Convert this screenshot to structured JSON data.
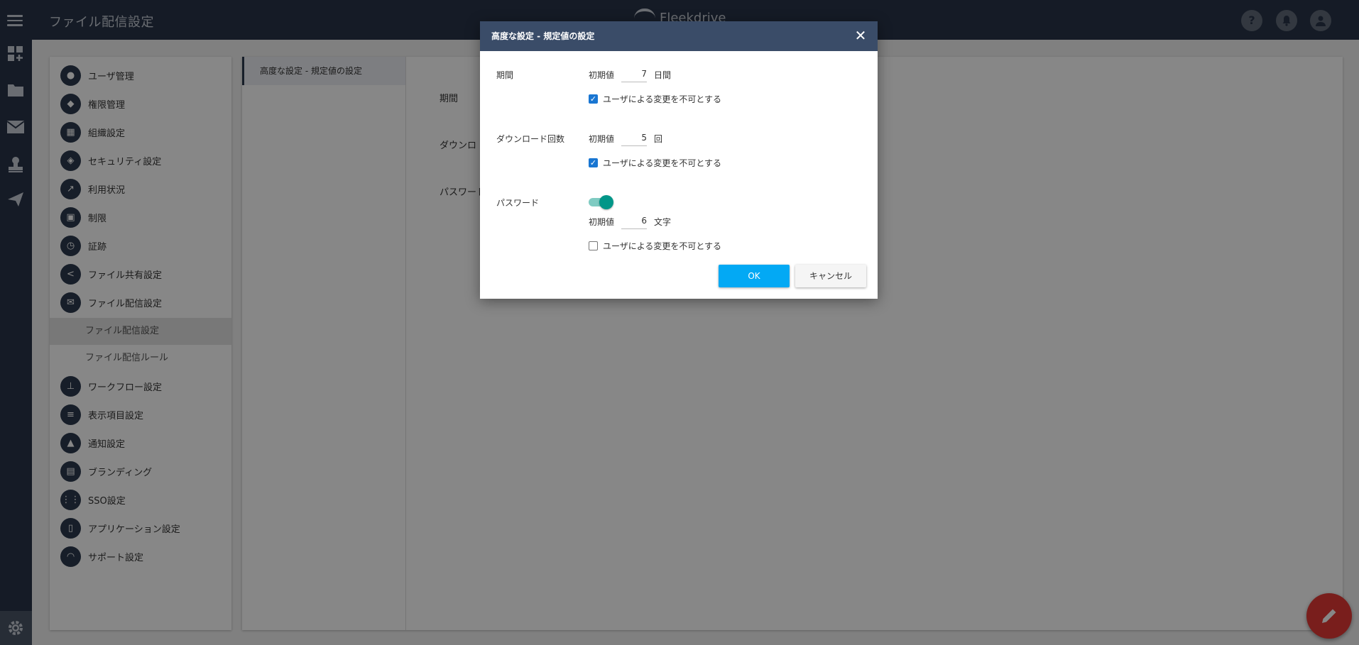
{
  "topbar": {
    "page_title": "ファイル配信設定",
    "brand": "Fleekdrive",
    "help_icon": "?",
    "bell_icon": "bell-icon",
    "avatar_icon": "user-icon"
  },
  "rail": {
    "icons": [
      "dashboard-add-icon",
      "folder-icon",
      "mail-icon",
      "stamp-icon",
      "send-icon"
    ],
    "bottom_icon": "gear-icon"
  },
  "nav": {
    "items": [
      {
        "label": "ユーザ管理",
        "icon": "user-icon"
      },
      {
        "label": "権限管理",
        "icon": "shield-check-icon"
      },
      {
        "label": "組織設定",
        "icon": "building-icon"
      },
      {
        "label": "セキュリティ設定",
        "icon": "security-icon"
      },
      {
        "label": "利用状況",
        "icon": "chart-icon"
      },
      {
        "label": "制限",
        "icon": "folder-lock-icon"
      },
      {
        "label": "証跡",
        "icon": "clock-icon"
      },
      {
        "label": "ファイル共有設定",
        "icon": "share-icon"
      },
      {
        "label": "ファイル配信設定",
        "icon": "mail-icon"
      }
    ],
    "sub_items": [
      {
        "label": "ファイル配信設定"
      },
      {
        "label": "ファイル配信ルール"
      }
    ],
    "items_after": [
      {
        "label": "ワークフロー設定",
        "icon": "stamp-icon"
      },
      {
        "label": "表示項目設定",
        "icon": "list-icon"
      },
      {
        "label": "通知設定",
        "icon": "bell-icon"
      },
      {
        "label": "ブランディング",
        "icon": "branding-icon"
      },
      {
        "label": "SSO設定",
        "icon": "sso-icon"
      },
      {
        "label": "アプリケーション設定",
        "icon": "app-icon"
      },
      {
        "label": "サポート設定",
        "icon": "support-icon"
      }
    ]
  },
  "subnav": {
    "selected": "高度な設定 - 規定値の設定"
  },
  "background_labels": {
    "period": "期間",
    "downloads": "ダウンロ",
    "password": "パスワード"
  },
  "dialog": {
    "title": "高度な設定 - 規定値の設定",
    "close_icon": "✕",
    "period": {
      "label": "期間",
      "initial_label": "初期値",
      "value": "7",
      "unit": "日間",
      "lock_label": "ユーザによる変更を不可とする",
      "lock_checked": true
    },
    "downloads": {
      "label": "ダウンロード回数",
      "initial_label": "初期値",
      "value": "5",
      "unit": "回",
      "lock_label": "ユーザによる変更を不可とする",
      "lock_checked": true
    },
    "password": {
      "label": "パスワード",
      "toggle_on": true,
      "initial_label": "初期値",
      "value": "6",
      "unit": "文字",
      "lock_label": "ユーザによる変更を不可とする",
      "lock_checked": false
    },
    "ok_label": "OK",
    "cancel_label": "キャンセル"
  },
  "fab_icon": "pencil-icon"
}
